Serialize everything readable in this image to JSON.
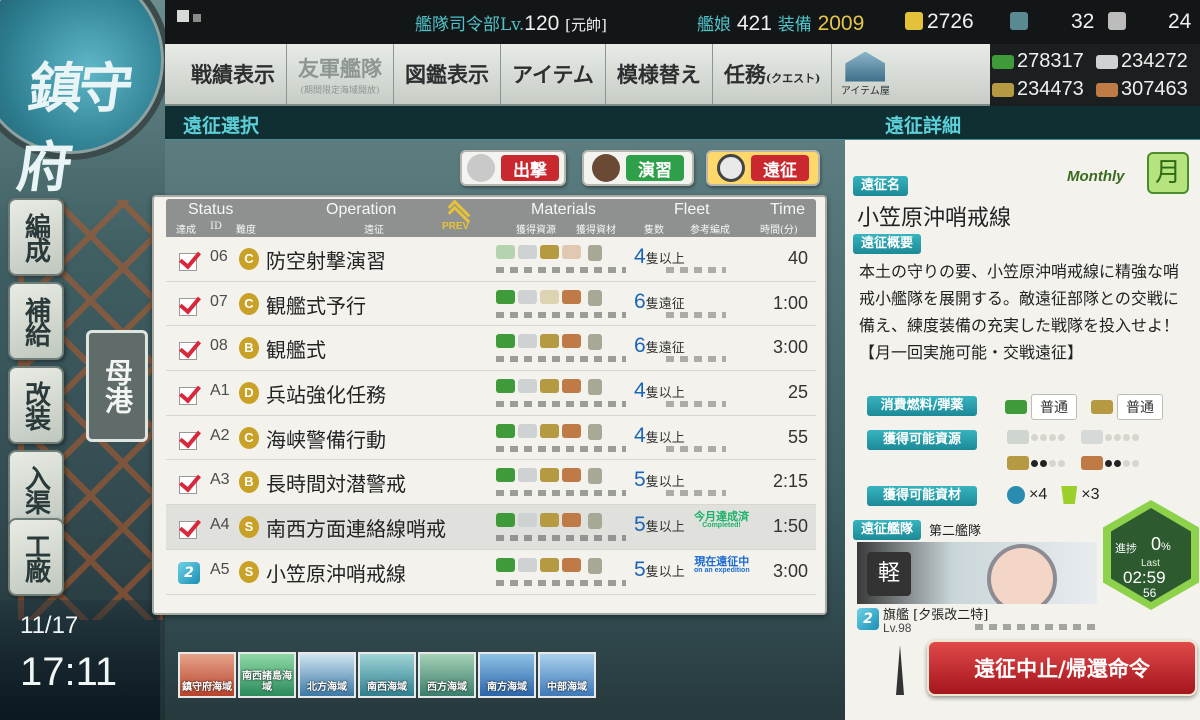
{
  "left_dock": {
    "emblem": "鎮守府",
    "menu": [
      {
        "label": "編成"
      },
      {
        "label": "補給"
      },
      {
        "label": "改装"
      },
      {
        "label": "入渠"
      },
      {
        "label": "工廠"
      }
    ],
    "home_label": "母港",
    "date": "11/17",
    "time": "17:11"
  },
  "top_bar": {
    "hq_label": "艦隊司令部Lv.",
    "hq_level": "120",
    "rank": "[元帥]",
    "ships_label": "艦娘",
    "ships": "421",
    "equip_label": "装備",
    "equip": "2009",
    "bucket": "2726",
    "dev_mat": "32",
    "screw": "24"
  },
  "nav": {
    "items": [
      {
        "label": "戦績表示"
      },
      {
        "label": "友軍艦隊",
        "sub": "(期間限定海域開放)"
      },
      {
        "label": "図鑑表示"
      },
      {
        "label": "アイテム"
      },
      {
        "label": "模様替え"
      },
      {
        "label": "任務",
        "small": "(クエスト)"
      }
    ],
    "shop_label": "アイテム屋"
  },
  "resources": {
    "fuel": "278317",
    "steel": "234272",
    "ammo": "234473",
    "bauxite": "307463"
  },
  "section": {
    "left_title": "遠征選択",
    "right_title": "遠征詳細"
  },
  "tabs": {
    "sortie": "出撃",
    "practice": "演習",
    "expedition": "遠征"
  },
  "op_table": {
    "headers": {
      "status": "Status",
      "status_sub": "達成",
      "id_sub": "ID",
      "diff_sub": "難度",
      "operation": "Operation",
      "operation_sub": "遠征",
      "materials": "Materials",
      "mat_sub1": "獲得資源",
      "mat_sub2": "獲得資材",
      "fleet": "Fleet",
      "fleet_sub1": "隻数",
      "fleet_sub2": "参考編成",
      "time": "Time",
      "time_sub": "時間(分)"
    },
    "prev_label": "PREV",
    "rows": [
      {
        "id": "06",
        "diff": "C",
        "name": "防空射撃演習",
        "fleet": "4",
        "unit": "隻以上",
        "note": "",
        "note_sub": "",
        "time": "40",
        "status": "done"
      },
      {
        "id": "07",
        "diff": "C",
        "name": "観艦式予行",
        "fleet": "6",
        "unit": "隻遠征",
        "note": "",
        "note_sub": "",
        "time": "1:00",
        "status": "done"
      },
      {
        "id": "08",
        "diff": "B",
        "name": "観艦式",
        "fleet": "6",
        "unit": "隻遠征",
        "note": "",
        "note_sub": "",
        "time": "3:00",
        "status": "done"
      },
      {
        "id": "A1",
        "diff": "D",
        "name": "兵站強化任務",
        "fleet": "4",
        "unit": "隻以上",
        "note": "",
        "note_sub": "",
        "time": "25",
        "status": "done"
      },
      {
        "id": "A2",
        "diff": "C",
        "name": "海峡警備行動",
        "fleet": "4",
        "unit": "隻以上",
        "note": "",
        "note_sub": "",
        "time": "55",
        "status": "done"
      },
      {
        "id": "A3",
        "diff": "B",
        "name": "長時間対潜警戒",
        "fleet": "5",
        "unit": "隻以上",
        "note": "",
        "note_sub": "",
        "time": "2:15",
        "status": "done"
      },
      {
        "id": "A4",
        "diff": "S",
        "name": "南西方面連絡線哨戒",
        "fleet": "5",
        "unit": "隻以上",
        "note": "今月達成済",
        "note_sub": "Completed!",
        "time": "1:50",
        "status": "done"
      },
      {
        "id": "A5",
        "diff": "S",
        "name": "小笠原沖哨戒線",
        "fleet": "5",
        "unit": "隻以上",
        "note": "現在遠征中",
        "note_sub": "on an expedition",
        "time": "3:00",
        "status": "inprogress"
      }
    ]
  },
  "sea_areas": [
    {
      "label": "鎮守府海域"
    },
    {
      "label": "南西諸島海域"
    },
    {
      "label": "北方海域"
    },
    {
      "label": "南西海域"
    },
    {
      "label": "西方海域"
    },
    {
      "label": "南方海域"
    },
    {
      "label": "中部海域"
    }
  ],
  "detail": {
    "name_label": "遠征名",
    "frequency": "Monthly",
    "frequency_kanji": "月",
    "title": "小笠原沖哨戒線",
    "summary_label": "遠征概要",
    "summary": "本土の守りの要、小笠原沖哨戒線に精強な哨戒小艦隊を展開する。敵遠征部隊との交戦に備え、練度装備の充実した戦隊を投入せよ！【月一回実施可能・交戦遠征】",
    "cost_label": "消費燃料/弾薬",
    "fuel_cost": "普通",
    "ammo_cost": "普通",
    "reward_label": "獲得可能資源",
    "items_label": "獲得可能資材",
    "item1_count": "×4",
    "item2_count": "×3",
    "fleet_label": "遠征艦隊",
    "fleet_name": "第二艦隊",
    "flagship_tag": "軽",
    "flagship": "旗艦 [夕張改二特]",
    "flagship_lv": "Lv.98",
    "progress_label": "進捗",
    "progress": "0",
    "progress_unit": "%",
    "last_label": "Last",
    "last_time": "02:59",
    "last_sec": "56",
    "recall_button": "遠征中止/帰還命令"
  },
  "colors": {
    "teal": "#38b3c0",
    "check_red": "#d8283c",
    "fleet_blue": "#1b65b8",
    "completed_green": "#1cb26a",
    "recall_red": "#c0262d"
  }
}
